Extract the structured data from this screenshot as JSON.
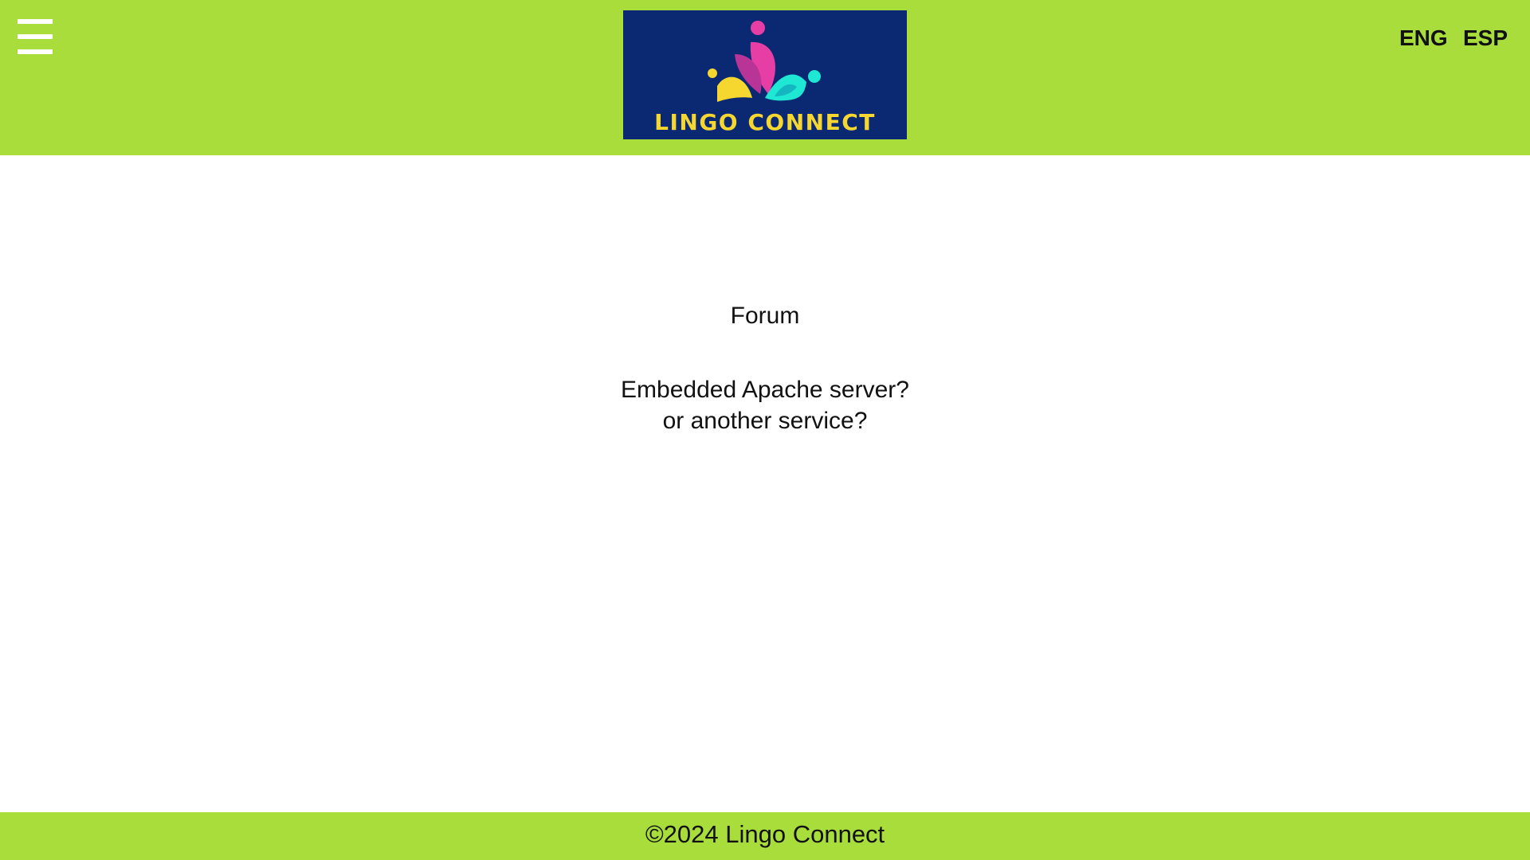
{
  "header": {
    "menu_icon": "hamburger-menu-icon",
    "logo_text": "LINGO CONNECT",
    "languages": [
      "ENG",
      "ESP"
    ]
  },
  "main": {
    "title": "Forum",
    "body_line1": "Embedded Apache server?",
    "body_line2": "or another service?"
  },
  "footer": {
    "copyright": "©2024 Lingo Connect"
  },
  "colors": {
    "header_bg": "#a8dd3c",
    "logo_bg": "#0b2873",
    "logo_text": "#f5d730",
    "logo_pink": "#e63ea4",
    "logo_yellow": "#f5d730",
    "logo_cyan": "#1ee8d4"
  }
}
